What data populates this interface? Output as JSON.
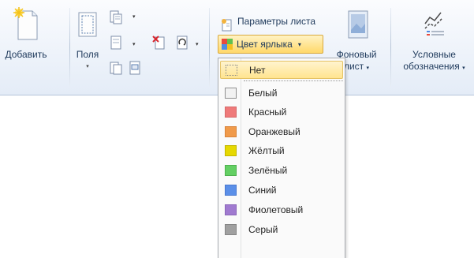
{
  "ribbon": {
    "add_button": {
      "label": "Добавить",
      "icon": "new-sheet-icon"
    },
    "margins_button": {
      "label": "Поля",
      "icon": "margins-icon"
    },
    "sheet_params": {
      "label": "Параметры листа",
      "icon": "page-setup-icon"
    },
    "tab_color": {
      "label": "Цвет ярлыка",
      "icon": "tab-color-icon",
      "arrow": "▾"
    },
    "background_button": {
      "label_line1": "Фоновый",
      "label_line2": "лист",
      "icon": "background-sheet-icon"
    },
    "legend_button": {
      "label_line1": "Условные",
      "label_line2": "обозначения",
      "icon": "legend-icon"
    },
    "dropdown_arrow": "▾"
  },
  "tab_color_menu": {
    "items": [
      {
        "label": "Нет",
        "color": "none",
        "selected": true
      },
      {
        "label": "Белый",
        "color": "#f2f2f2"
      },
      {
        "label": "Красный",
        "color": "#ef7a7a"
      },
      {
        "label": "Оранжевый",
        "color": "#f09a4a"
      },
      {
        "label": "Жёлтый",
        "color": "#e6d800"
      },
      {
        "label": "Зелёный",
        "color": "#63cf63"
      },
      {
        "label": "Синий",
        "color": "#5b8fe8"
      },
      {
        "label": "Фиолетовый",
        "color": "#a07ad0"
      },
      {
        "label": "Серый",
        "color": "#a0a0a0"
      }
    ]
  }
}
